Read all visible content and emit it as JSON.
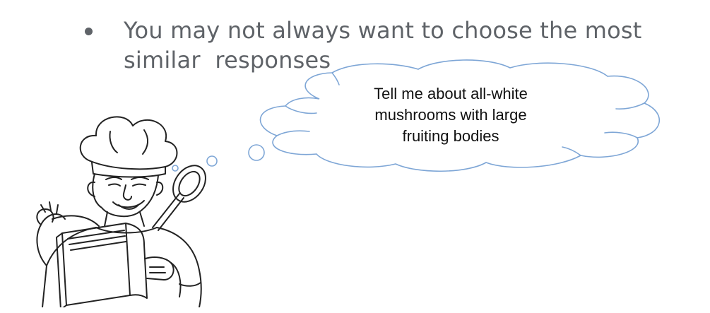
{
  "slide": {
    "bullet": "You may not always want to choose the most similar  responses",
    "bubble_lines": [
      "Tell me about all-white",
      "mushrooms with large",
      "fruiting bodies"
    ]
  },
  "colors": {
    "bullet_text": "#5f6368",
    "bubble_outline": "#7ea6d6",
    "bubble_text": "#111111",
    "drawing_line": "#222222"
  },
  "icons": {
    "bullet": "bullet-dot-icon",
    "bubble": "thought-bubble-icon",
    "chef": "chef-reading-cookbook-icon"
  }
}
